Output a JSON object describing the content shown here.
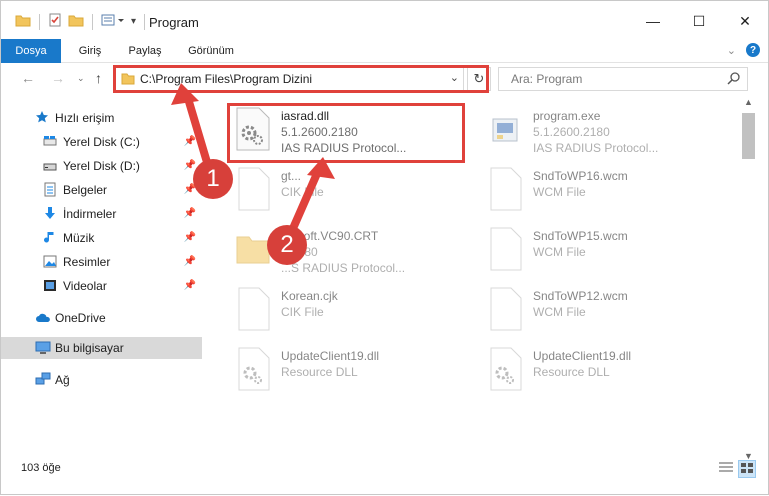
{
  "window": {
    "title": "Program",
    "controls": {
      "minimize": "—",
      "maximize": "☐",
      "close": "✕"
    }
  },
  "ribbon": {
    "tabs": [
      "Dosya",
      "Giriş",
      "Paylaş",
      "Görünüm"
    ],
    "active_tab": "Dosya",
    "help": "?"
  },
  "address_bar": {
    "path": "C:\\Program Files\\Program Dizini",
    "search_placeholder": "Ara: Program"
  },
  "nav_pane": {
    "items": [
      {
        "label": "Hızlı erişim",
        "icon": "star-icon",
        "pinned": false
      },
      {
        "label": "Yerel Disk (C:)",
        "icon": "drive-icon",
        "pinned": true
      },
      {
        "label": "Yerel Disk (D:)",
        "icon": "drive-icon",
        "pinned": true
      },
      {
        "label": "Belgeler",
        "icon": "documents-icon",
        "pinned": true
      },
      {
        "label": "İndirmeler",
        "icon": "download-icon",
        "pinned": true
      },
      {
        "label": "Müzik",
        "icon": "music-icon",
        "pinned": true
      },
      {
        "label": "Resimler",
        "icon": "pictures-icon",
        "pinned": true
      },
      {
        "label": "Videolar",
        "icon": "videos-icon",
        "pinned": true
      },
      {
        "label": "OneDrive",
        "icon": "cloud-icon",
        "pinned": false
      },
      {
        "label": "Bu bilgisayar",
        "icon": "computer-icon",
        "pinned": false
      },
      {
        "label": "Ağ",
        "icon": "network-icon",
        "pinned": false
      }
    ],
    "selected": "Bu bilgisayar"
  },
  "files": [
    {
      "name": "iasrad.dll",
      "line2": "5.1.2600.2180",
      "line3": "IAS RADIUS Protocol...",
      "icon": "dll-gear-icon",
      "highlighted": true
    },
    {
      "name": "program.exe",
      "line2": "5.1.2600.2180",
      "line3": "IAS RADIUS Protocol...",
      "icon": "exe-icon"
    },
    {
      "name": "gt...",
      "line2": "CIK File",
      "line3": "",
      "icon": "blank-file-icon"
    },
    {
      "name": "SndToWP16.wcm",
      "line2": "WCM File",
      "line3": "",
      "icon": "blank-file-icon"
    },
    {
      "name": "...osoft.VC90.CRT",
      "line2": "...2180",
      "line3": "...S RADIUS Protocol...",
      "icon": "folder-icon"
    },
    {
      "name": "SndToWP15.wcm",
      "line2": "WCM File",
      "line3": "",
      "icon": "blank-file-icon"
    },
    {
      "name": "Korean.cjk",
      "line2": "CIK File",
      "line3": "",
      "icon": "blank-file-icon"
    },
    {
      "name": "SndToWP12.wcm",
      "line2": "WCM File",
      "line3": "",
      "icon": "blank-file-icon"
    },
    {
      "name": "UpdateClient19.dll",
      "line2": "Resource DLL",
      "line3": "",
      "icon": "dll-gear-icon"
    },
    {
      "name": "UpdateClient19.dll",
      "line2": "Resource DLL",
      "line3": "",
      "icon": "dll-gear-icon"
    }
  ],
  "status_bar": {
    "count": "103 öğe"
  },
  "annotations": {
    "step1": "1",
    "step2": "2",
    "color": "#e0413b"
  }
}
